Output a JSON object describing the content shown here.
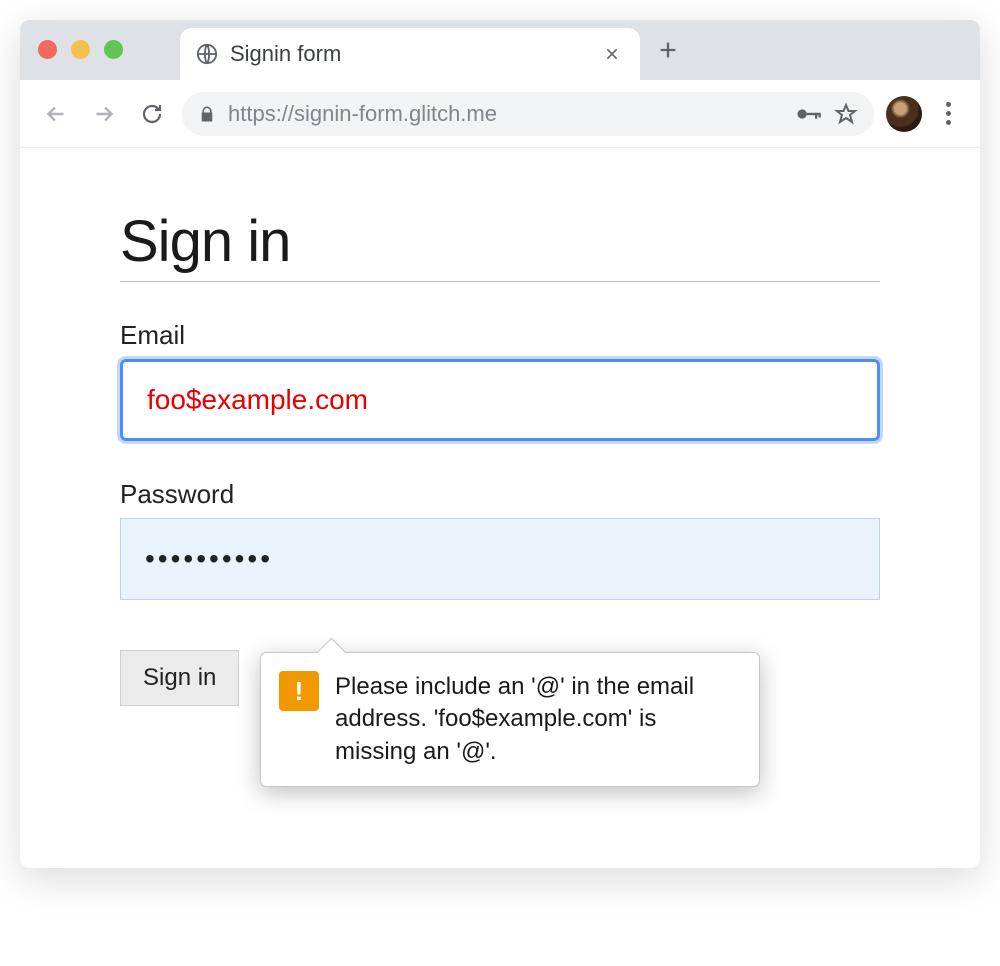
{
  "browser": {
    "tab_title": "Signin form",
    "url": "https://signin-form.glitch.me"
  },
  "page": {
    "heading": "Sign in",
    "email_label": "Email",
    "email_value": "foo$example.com",
    "password_label": "Password",
    "password_value": "••••••••••",
    "submit_label": "Sign in"
  },
  "validation": {
    "message": "Please include an '@' in the email address. 'foo$example.com' is missing an '@'."
  }
}
